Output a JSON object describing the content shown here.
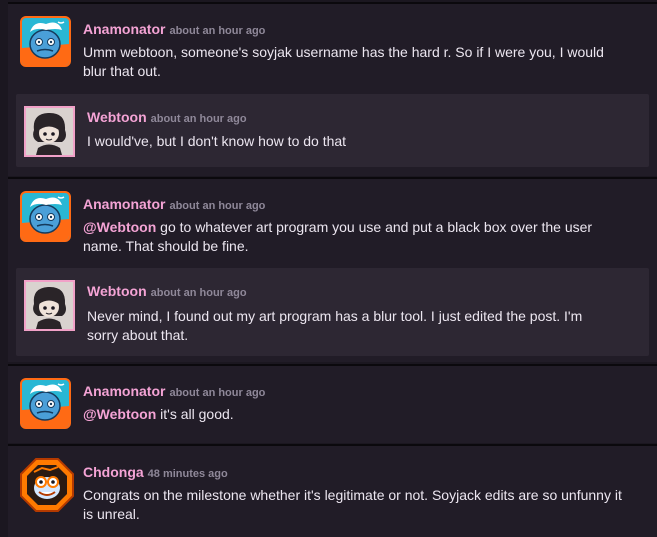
{
  "comments": [
    {
      "author": "Anamonator",
      "time": "about an hour ago",
      "text": "Umm webtoon, someone's soyjak username has the hard r. So if I were you, I would blur that out.",
      "reply": {
        "author": "Webtoon",
        "time": "about an hour ago",
        "text": "I would've, but I don't know how to do that"
      }
    },
    {
      "author": "Anamonator",
      "time": "about an hour ago",
      "mention": "@Webtoon",
      "text": " go to whatever art program you use and put a black box over the user name. That should be fine.",
      "reply": {
        "author": "Webtoon",
        "time": "about an hour ago",
        "text": "Never mind, I found out my art program has a blur tool. I just edited the post. I'm sorry about that."
      }
    },
    {
      "author": "Anamonator",
      "time": "about an hour ago",
      "mention": "@Webtoon",
      "text": " it's all good."
    },
    {
      "author": "Chdonga",
      "time": "48 minutes ago",
      "text": "Congrats on the milestone whether it's legitimate or not. Soyjack edits are so unfunny it is unreal."
    }
  ],
  "colors": {
    "username": "#f4a3d5",
    "background": "#1b1720",
    "comment_bg": "#211c27",
    "reply_bg": "#2d2733"
  },
  "icons": {
    "anamonator_avatar": "blue-cartoon-face-avatar",
    "webtoon_avatar": "dark-haired-character-avatar",
    "chdonga_avatar": "orange-octagon-goggles-avatar"
  }
}
